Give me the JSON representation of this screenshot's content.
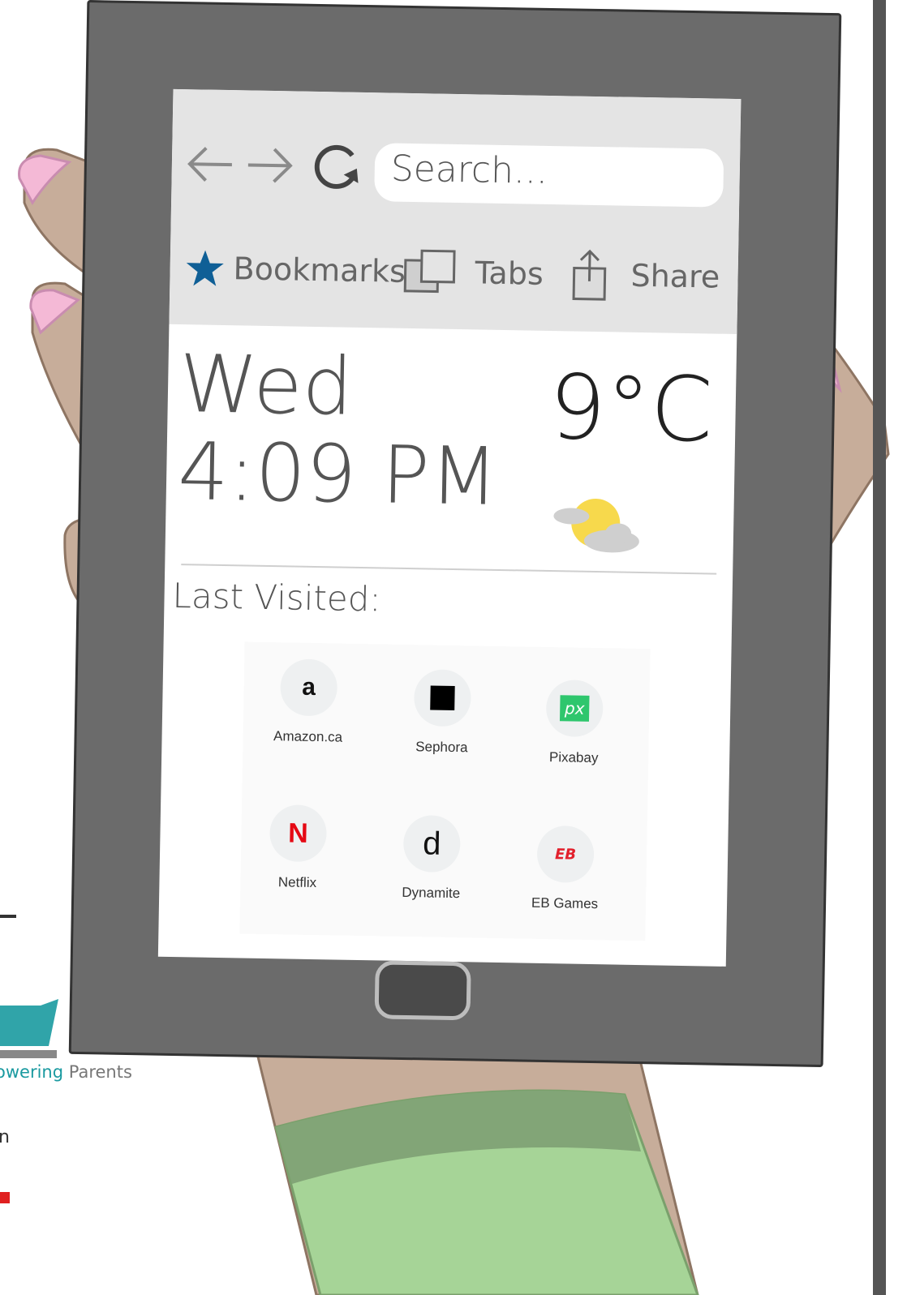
{
  "browser": {
    "back_icon": "arrow-left-icon",
    "forward_icon": "arrow-right-icon",
    "reload_icon": "reload-icon",
    "search_placeholder": "Search...",
    "toolbar": {
      "bookmarks_label": "Bookmarks",
      "tabs_label": "Tabs",
      "share_label": "Share"
    }
  },
  "widget": {
    "day": "Wed",
    "time": "4:09 PM",
    "temperature": "9°C",
    "weather_icon": "partly-cloudy-icon"
  },
  "last_visited": {
    "heading": "Last Visited:",
    "sites": [
      {
        "label": "Amazon.ca",
        "icon": "amazon-logo-icon"
      },
      {
        "label": "Sephora",
        "icon": "sephora-logo-icon"
      },
      {
        "label": "Pixabay",
        "icon": "pixabay-logo-icon"
      },
      {
        "label": "Netflix",
        "icon": "netflix-logo-icon"
      },
      {
        "label": "Dynamite",
        "icon": "dynamite-logo-icon"
      },
      {
        "label": "EB Games",
        "icon": "eb-games-logo-icon"
      }
    ]
  },
  "partial_branding": {
    "text_teal": "owering",
    "text_gray": "Parents",
    "line2": "n"
  },
  "colors": {
    "bezel": "#6b6b6b",
    "toolbar": "#e4e4e4",
    "star": "#0f5f96",
    "skin": "#c7ad9a",
    "nail": "#f4b9d6",
    "sleeve": "#a6d497",
    "sleeve_band": "#82a577",
    "teal": "#1a9aa0"
  }
}
